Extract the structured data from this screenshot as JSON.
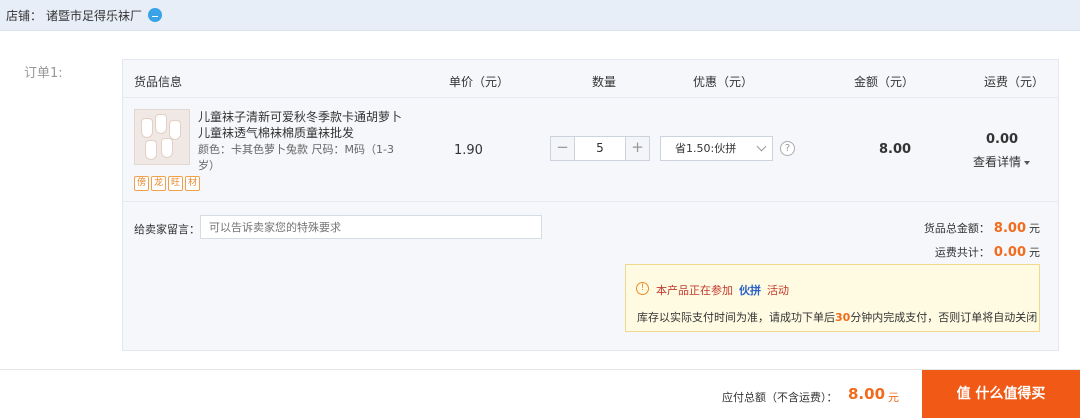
{
  "shop": {
    "label": "店铺：",
    "name": "诸暨市足得乐袜厂"
  },
  "order": {
    "label": "订单1:"
  },
  "table": {
    "headers": {
      "goods": "货品信息",
      "unit_price": "单价（元）",
      "quantity": "数量",
      "discount": "优惠（元）",
      "amount": "金额（元）",
      "shipping": "运费（元）"
    }
  },
  "item": {
    "title": "儿童袜子清新可爱秋冬季款卡通胡萝卜儿童袜透气棉袜棉质童袜批发",
    "attrs": "颜色：卡其色萝卜兔款    尺码：M码（1-3岁）",
    "badges": [
      "傍",
      "龙",
      "旺",
      "材"
    ],
    "unit_price": "1.90",
    "quantity": "5",
    "minus": "−",
    "plus": "+",
    "promo": "省1.50:伙拼",
    "help": "?",
    "amount": "8.00",
    "shipping": "0.00",
    "detail_link": "查看详情"
  },
  "message": {
    "label": "给卖家留言：",
    "placeholder": "可以告诉卖家您的特殊要求"
  },
  "summary": {
    "goods_total_label": "货品总金额：",
    "goods_total": "8.00",
    "shipping_total_label": "运费共计：",
    "shipping_total": "0.00",
    "unit": "元"
  },
  "notice": {
    "icon": "!",
    "prefix": "本产品正在参加",
    "activity": "伙拼",
    "suffix": "活动",
    "line2_a": "库存以实际支付时间为准，请成功下单后",
    "line2_minutes": "30",
    "line2_b": "分钟内完成支付，否则订单将自动关闭"
  },
  "footer": {
    "total_label": "应付总额（不含运费）：",
    "total": "8.00",
    "unit": "元",
    "submit_label": "值 什么值得买"
  },
  "colors": {
    "accent": "#f26a1b",
    "link_blue": "#2a62c9",
    "header_bg": "#e8eef7"
  }
}
